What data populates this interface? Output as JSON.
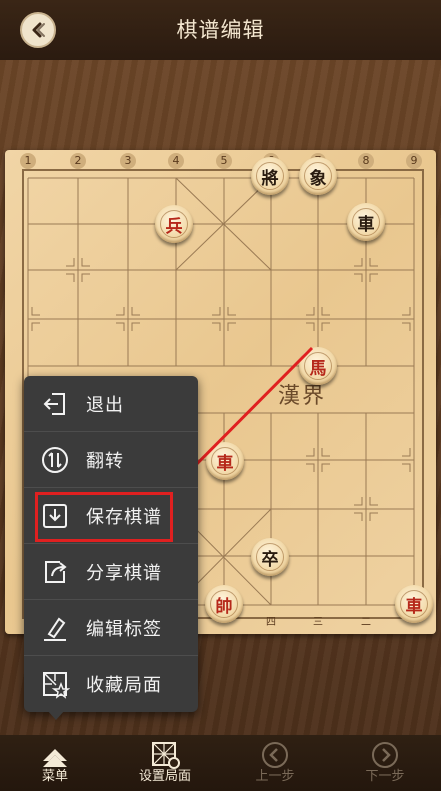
{
  "header": {
    "title": "棋谱编辑"
  },
  "board": {
    "top_numbers": [
      "1",
      "2",
      "3",
      "4",
      "5",
      "6",
      "7",
      "8",
      "9"
    ],
    "bottom_numbers": [
      "四",
      "三",
      "二"
    ],
    "river_text": "漢界"
  },
  "pieces": [
    {
      "char": "將",
      "side": "black"
    },
    {
      "char": "象",
      "side": "black"
    },
    {
      "char": "兵",
      "side": "red"
    },
    {
      "char": "車",
      "side": "black"
    },
    {
      "char": "馬",
      "side": "red"
    },
    {
      "char": "車",
      "side": "red"
    },
    {
      "char": "卒",
      "side": "black"
    },
    {
      "char": "帥",
      "side": "red"
    },
    {
      "char": "車",
      "side": "red"
    }
  ],
  "menu": {
    "items": [
      {
        "label": "退出",
        "icon": "exit-icon"
      },
      {
        "label": "翻转",
        "icon": "flip-icon"
      },
      {
        "label": "保存棋谱",
        "icon": "save-download-icon"
      },
      {
        "label": "分享棋谱",
        "icon": "share-icon"
      },
      {
        "label": "编辑标签",
        "icon": "edit-pen-icon"
      },
      {
        "label": "收藏局面",
        "icon": "favorite-board-icon"
      }
    ]
  },
  "bottom_bar": {
    "tabs": [
      {
        "label": "菜单",
        "icon": "menu-icon",
        "state": "active"
      },
      {
        "label": "设置局面",
        "icon": "board-setup-icon",
        "state": "active"
      },
      {
        "label": "上一步",
        "icon": "prev-step-icon",
        "state": "disabled"
      },
      {
        "label": "下一步",
        "icon": "next-step-icon",
        "state": "disabled"
      }
    ]
  },
  "colors": {
    "annotation_red": "#e02020",
    "red_piece": "#b6281a",
    "black_piece": "#2a1c10"
  }
}
